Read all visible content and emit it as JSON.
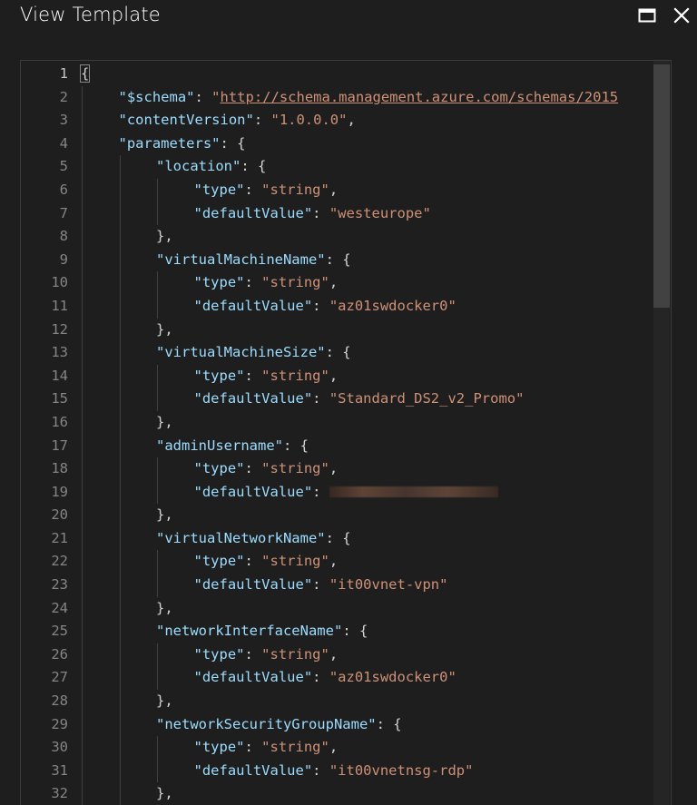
{
  "window": {
    "title": "View Template",
    "maximize_icon": "maximize-icon",
    "close_icon": "close-icon"
  },
  "editor": {
    "lines": [
      {
        "n": "1",
        "indent": 0,
        "tokens": [
          {
            "t": "p",
            "v": "{"
          }
        ]
      },
      {
        "n": "2",
        "indent": 1,
        "tokens": [
          {
            "t": "k",
            "v": "\"$schema\""
          },
          {
            "t": "p",
            "v": ": "
          },
          {
            "t": "s",
            "v": "\""
          },
          {
            "t": "link",
            "v": "http://schema.management.azure.com/schemas/2015"
          }
        ]
      },
      {
        "n": "3",
        "indent": 1,
        "tokens": [
          {
            "t": "k",
            "v": "\"contentVersion\""
          },
          {
            "t": "p",
            "v": ": "
          },
          {
            "t": "s",
            "v": "\"1.0.0.0\""
          },
          {
            "t": "p",
            "v": ","
          }
        ]
      },
      {
        "n": "4",
        "indent": 1,
        "tokens": [
          {
            "t": "k",
            "v": "\"parameters\""
          },
          {
            "t": "p",
            "v": ": {"
          }
        ]
      },
      {
        "n": "5",
        "indent": 2,
        "tokens": [
          {
            "t": "k",
            "v": "\"location\""
          },
          {
            "t": "p",
            "v": ": {"
          }
        ]
      },
      {
        "n": "6",
        "indent": 3,
        "tokens": [
          {
            "t": "k",
            "v": "\"type\""
          },
          {
            "t": "p",
            "v": ": "
          },
          {
            "t": "s",
            "v": "\"string\""
          },
          {
            "t": "p",
            "v": ","
          }
        ]
      },
      {
        "n": "7",
        "indent": 3,
        "tokens": [
          {
            "t": "k",
            "v": "\"defaultValue\""
          },
          {
            "t": "p",
            "v": ": "
          },
          {
            "t": "s",
            "v": "\"westeurope\""
          }
        ]
      },
      {
        "n": "8",
        "indent": 2,
        "tokens": [
          {
            "t": "p",
            "v": "},"
          }
        ]
      },
      {
        "n": "9",
        "indent": 2,
        "tokens": [
          {
            "t": "k",
            "v": "\"virtualMachineName\""
          },
          {
            "t": "p",
            "v": ": {"
          }
        ]
      },
      {
        "n": "10",
        "indent": 3,
        "tokens": [
          {
            "t": "k",
            "v": "\"type\""
          },
          {
            "t": "p",
            "v": ": "
          },
          {
            "t": "s",
            "v": "\"string\""
          },
          {
            "t": "p",
            "v": ","
          }
        ]
      },
      {
        "n": "11",
        "indent": 3,
        "tokens": [
          {
            "t": "k",
            "v": "\"defaultValue\""
          },
          {
            "t": "p",
            "v": ": "
          },
          {
            "t": "s",
            "v": "\"az01swdocker0\""
          }
        ]
      },
      {
        "n": "12",
        "indent": 2,
        "tokens": [
          {
            "t": "p",
            "v": "},"
          }
        ]
      },
      {
        "n": "13",
        "indent": 2,
        "tokens": [
          {
            "t": "k",
            "v": "\"virtualMachineSize\""
          },
          {
            "t": "p",
            "v": ": {"
          }
        ]
      },
      {
        "n": "14",
        "indent": 3,
        "tokens": [
          {
            "t": "k",
            "v": "\"type\""
          },
          {
            "t": "p",
            "v": ": "
          },
          {
            "t": "s",
            "v": "\"string\""
          },
          {
            "t": "p",
            "v": ","
          }
        ]
      },
      {
        "n": "15",
        "indent": 3,
        "tokens": [
          {
            "t": "k",
            "v": "\"defaultValue\""
          },
          {
            "t": "p",
            "v": ": "
          },
          {
            "t": "s",
            "v": "\"Standard_DS2_v2_Promo\""
          }
        ]
      },
      {
        "n": "16",
        "indent": 2,
        "tokens": [
          {
            "t": "p",
            "v": "},"
          }
        ]
      },
      {
        "n": "17",
        "indent": 2,
        "tokens": [
          {
            "t": "k",
            "v": "\"adminUsername\""
          },
          {
            "t": "p",
            "v": ": {"
          }
        ]
      },
      {
        "n": "18",
        "indent": 3,
        "tokens": [
          {
            "t": "k",
            "v": "\"type\""
          },
          {
            "t": "p",
            "v": ": "
          },
          {
            "t": "s",
            "v": "\"string\""
          },
          {
            "t": "p",
            "v": ","
          }
        ]
      },
      {
        "n": "19",
        "indent": 3,
        "tokens": [
          {
            "t": "k",
            "v": "\"defaultValue\""
          },
          {
            "t": "p",
            "v": ": "
          },
          {
            "t": "redacted",
            "v": ""
          }
        ]
      },
      {
        "n": "20",
        "indent": 2,
        "tokens": [
          {
            "t": "p",
            "v": "},"
          }
        ]
      },
      {
        "n": "21",
        "indent": 2,
        "tokens": [
          {
            "t": "k",
            "v": "\"virtualNetworkName\""
          },
          {
            "t": "p",
            "v": ": {"
          }
        ]
      },
      {
        "n": "22",
        "indent": 3,
        "tokens": [
          {
            "t": "k",
            "v": "\"type\""
          },
          {
            "t": "p",
            "v": ": "
          },
          {
            "t": "s",
            "v": "\"string\""
          },
          {
            "t": "p",
            "v": ","
          }
        ]
      },
      {
        "n": "23",
        "indent": 3,
        "tokens": [
          {
            "t": "k",
            "v": "\"defaultValue\""
          },
          {
            "t": "p",
            "v": ": "
          },
          {
            "t": "s",
            "v": "\"it00vnet-vpn\""
          }
        ]
      },
      {
        "n": "24",
        "indent": 2,
        "tokens": [
          {
            "t": "p",
            "v": "},"
          }
        ]
      },
      {
        "n": "25",
        "indent": 2,
        "tokens": [
          {
            "t": "k",
            "v": "\"networkInterfaceName\""
          },
          {
            "t": "p",
            "v": ": {"
          }
        ]
      },
      {
        "n": "26",
        "indent": 3,
        "tokens": [
          {
            "t": "k",
            "v": "\"type\""
          },
          {
            "t": "p",
            "v": ": "
          },
          {
            "t": "s",
            "v": "\"string\""
          },
          {
            "t": "p",
            "v": ","
          }
        ]
      },
      {
        "n": "27",
        "indent": 3,
        "tokens": [
          {
            "t": "k",
            "v": "\"defaultValue\""
          },
          {
            "t": "p",
            "v": ": "
          },
          {
            "t": "s",
            "v": "\"az01swdocker0\""
          }
        ]
      },
      {
        "n": "28",
        "indent": 2,
        "tokens": [
          {
            "t": "p",
            "v": "},"
          }
        ]
      },
      {
        "n": "29",
        "indent": 2,
        "tokens": [
          {
            "t": "k",
            "v": "\"networkSecurityGroupName\""
          },
          {
            "t": "p",
            "v": ": {"
          }
        ]
      },
      {
        "n": "30",
        "indent": 3,
        "tokens": [
          {
            "t": "k",
            "v": "\"type\""
          },
          {
            "t": "p",
            "v": ": "
          },
          {
            "t": "s",
            "v": "\"string\""
          },
          {
            "t": "p",
            "v": ","
          }
        ]
      },
      {
        "n": "31",
        "indent": 3,
        "tokens": [
          {
            "t": "k",
            "v": "\"defaultValue\""
          },
          {
            "t": "p",
            "v": ": "
          },
          {
            "t": "s",
            "v": "\"it00vnetnsg-rdp\""
          }
        ]
      },
      {
        "n": "32",
        "indent": 2,
        "tokens": [
          {
            "t": "p",
            "v": "},"
          }
        ]
      }
    ]
  },
  "colors": {
    "background": "#1e1e1e",
    "json_key": "#9cdcfe",
    "json_string": "#ce9178",
    "punctuation": "#d4d4d4",
    "line_number": "#858585"
  }
}
